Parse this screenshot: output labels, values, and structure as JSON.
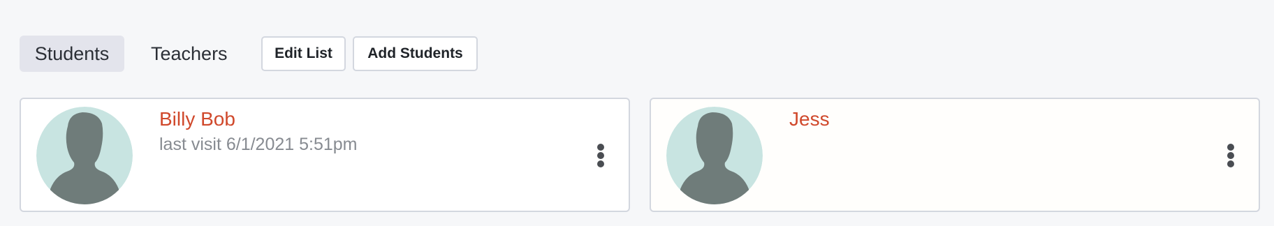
{
  "tabs": {
    "students_label": "Students",
    "teachers_label": "Teachers"
  },
  "toolbar": {
    "edit_list_label": "Edit List",
    "add_students_label": "Add Students"
  },
  "students": [
    {
      "name": "Billy Bob",
      "last_visit": "last visit 6/1/2021 5:51pm"
    },
    {
      "name": "Jess",
      "last_visit": ""
    }
  ],
  "icons": {
    "avatar": "default-avatar-silhouette-icon",
    "menu": "more-vertical-icon"
  },
  "colors": {
    "background": "#f6f7f9",
    "active_tab_bg": "#e3e4ec",
    "name_accent": "#d0492c",
    "avatar_bg": "#c8e4e1",
    "avatar_silhouette": "#6f7c7a",
    "border": "#d3d7df",
    "muted_text": "#878b91"
  }
}
